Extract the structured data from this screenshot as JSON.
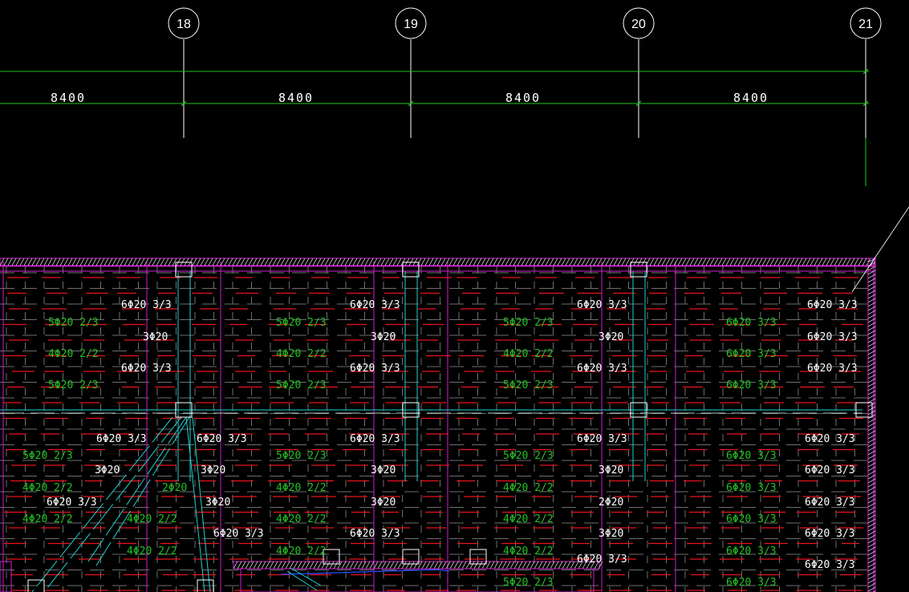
{
  "colors": {
    "background": "#000000",
    "axis_line": "#ffffff",
    "dimension_line": "#22c322",
    "dashed_grid": "#6e6e6e",
    "rebar_red": "#e8141e",
    "magenta": "#d21ed2",
    "cyan": "#20d0d0",
    "blue": "#2850ff",
    "text_white": "#ffffff",
    "text_green": "#22c322"
  },
  "axes": [
    {
      "id": "18",
      "label": "18"
    },
    {
      "id": "19",
      "label": "19"
    },
    {
      "id": "20",
      "label": "20"
    },
    {
      "id": "21",
      "label": "21"
    }
  ],
  "dimensions": [
    {
      "label": "8400"
    },
    {
      "label": "8400"
    },
    {
      "label": "8400"
    },
    {
      "label": "8400"
    }
  ],
  "rebar_labels": [
    {
      "text": "6Φ20 3/3",
      "color": "white"
    },
    {
      "text": "6Φ20 3/3",
      "color": "white"
    },
    {
      "text": "6Φ20 3/3",
      "color": "white"
    },
    {
      "text": "6Φ20 3/3",
      "color": "white"
    },
    {
      "text": "5Φ20 2/3",
      "color": "green"
    },
    {
      "text": "5Φ20 2/3",
      "color": "green"
    },
    {
      "text": "5Φ20 2/3",
      "color": "green"
    },
    {
      "text": "6Φ20 3/3",
      "color": "green"
    },
    {
      "text": "3Φ20",
      "color": "white"
    },
    {
      "text": "3Φ20",
      "color": "white"
    },
    {
      "text": "3Φ20",
      "color": "white"
    },
    {
      "text": "6Φ20 3/3",
      "color": "white"
    },
    {
      "text": "4Φ20 2/2",
      "color": "green"
    },
    {
      "text": "4Φ20 2/2",
      "color": "green"
    },
    {
      "text": "4Φ20 2/2",
      "color": "green"
    },
    {
      "text": "6Φ20 3/3",
      "color": "green"
    },
    {
      "text": "6Φ20 3/3",
      "color": "white"
    },
    {
      "text": "6Φ20 3/3",
      "color": "white"
    },
    {
      "text": "6Φ20 3/3",
      "color": "white"
    },
    {
      "text": "6Φ20 3/3",
      "color": "white"
    },
    {
      "text": "5Φ20 2/3",
      "color": "green"
    },
    {
      "text": "5Φ20 2/3",
      "color": "green"
    },
    {
      "text": "5Φ20 2/3",
      "color": "green"
    },
    {
      "text": "6Φ20 3/3",
      "color": "green"
    },
    {
      "text": "6Φ20 3/3",
      "color": "white"
    },
    {
      "text": "6Φ20 3/3",
      "color": "white"
    },
    {
      "text": "6Φ20 3/3",
      "color": "white"
    },
    {
      "text": "6Φ20 3/3",
      "color": "white"
    },
    {
      "text": "6Φ20 3/3",
      "color": "white"
    },
    {
      "text": "5Φ20 2/3",
      "color": "green"
    },
    {
      "text": "5Φ20 2/3",
      "color": "green"
    },
    {
      "text": "5Φ20 2/3",
      "color": "green"
    },
    {
      "text": "6Φ20 3/3",
      "color": "green"
    },
    {
      "text": "3Φ20",
      "color": "white"
    },
    {
      "text": "3Φ20",
      "color": "white"
    },
    {
      "text": "3Φ20",
      "color": "white"
    },
    {
      "text": "3Φ20",
      "color": "white"
    },
    {
      "text": "6Φ20 3/3",
      "color": "white"
    },
    {
      "text": "4Φ20 2/2",
      "color": "green"
    },
    {
      "text": "2Φ20",
      "color": "green"
    },
    {
      "text": "4Φ20 2/2",
      "color": "green"
    },
    {
      "text": "4Φ20 2/2",
      "color": "green"
    },
    {
      "text": "6Φ20 3/3",
      "color": "green"
    },
    {
      "text": "6Φ20 3/3",
      "color": "white"
    },
    {
      "text": "3Φ20",
      "color": "white"
    },
    {
      "text": "3Φ20",
      "color": "white"
    },
    {
      "text": "2Φ20",
      "color": "white"
    },
    {
      "text": "6Φ20 3/3",
      "color": "white"
    },
    {
      "text": "4Φ20 2/2",
      "color": "green"
    },
    {
      "text": "4Φ20 2/2",
      "color": "green"
    },
    {
      "text": "4Φ20 2/2",
      "color": "green"
    },
    {
      "text": "4Φ20 2/2",
      "color": "green"
    },
    {
      "text": "6Φ20 3/3",
      "color": "green"
    },
    {
      "text": "6Φ20 3/3",
      "color": "white"
    },
    {
      "text": "6Φ20 3/3",
      "color": "white"
    },
    {
      "text": "3Φ20",
      "color": "white"
    },
    {
      "text": "6Φ20 3/3",
      "color": "white"
    },
    {
      "text": "4Φ20 2/2",
      "color": "green"
    },
    {
      "text": "4Φ20 2/2",
      "color": "green"
    },
    {
      "text": "4Φ20 2/2",
      "color": "green"
    },
    {
      "text": "6Φ20 3/3",
      "color": "green"
    },
    {
      "text": "6Φ20 3/3",
      "color": "white"
    },
    {
      "text": "6Φ20 3/3",
      "color": "white"
    },
    {
      "text": "5Φ20 2/3",
      "color": "green"
    },
    {
      "text": "6Φ20 3/3",
      "color": "green"
    }
  ]
}
